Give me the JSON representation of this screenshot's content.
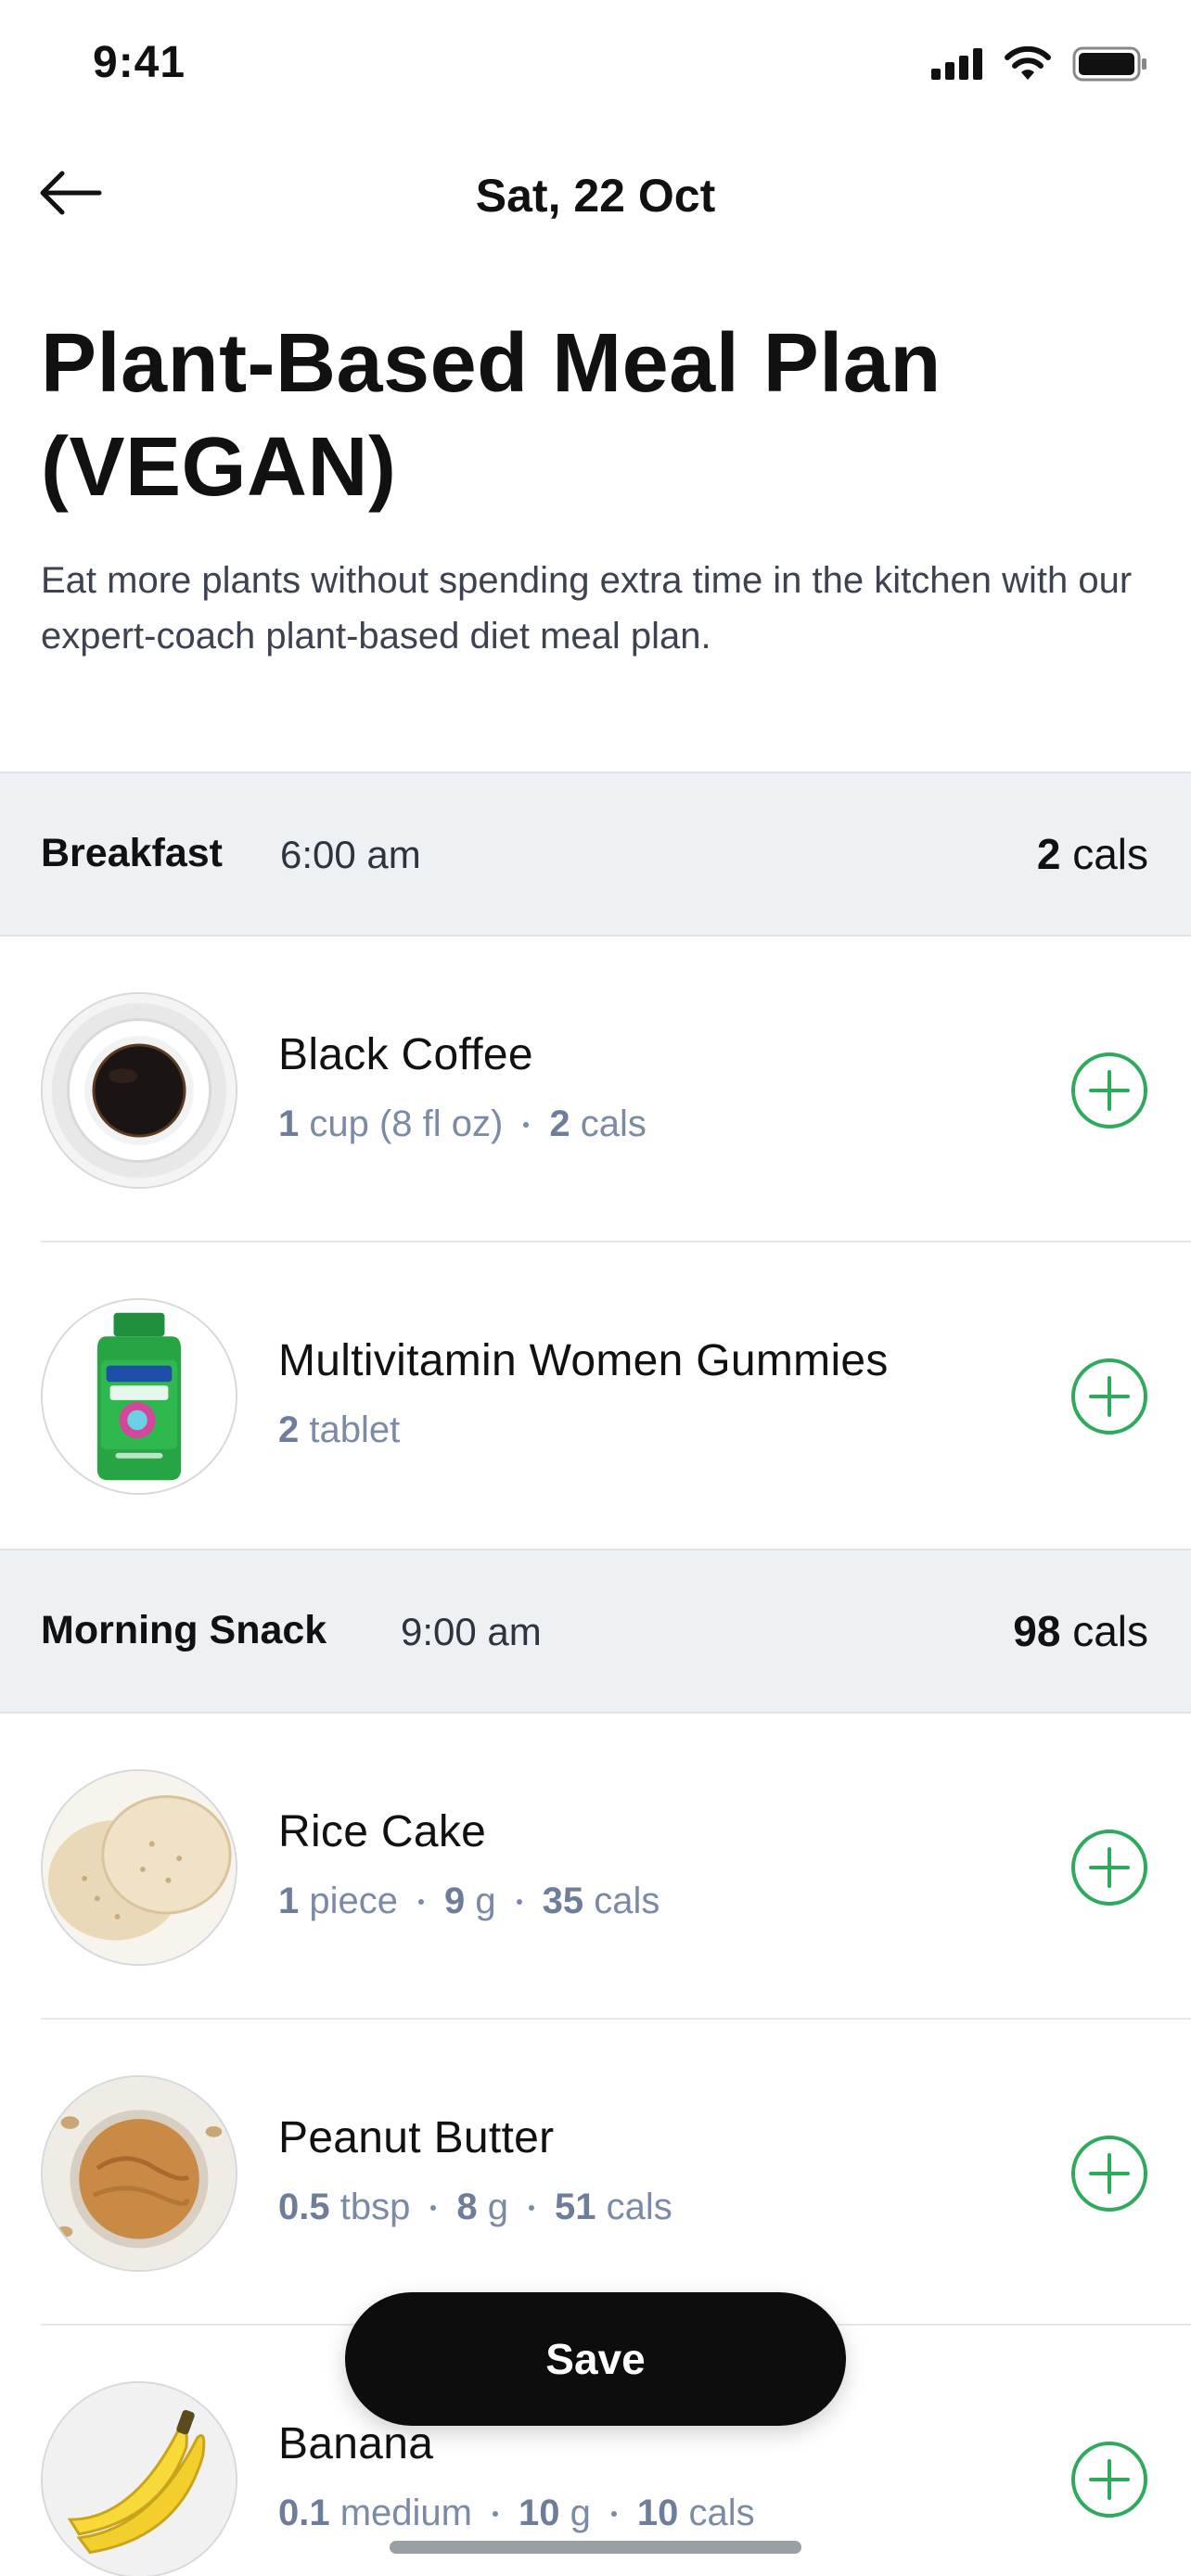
{
  "status_bar": {
    "time": "9:41"
  },
  "nav": {
    "title": "Sat, 22 Oct"
  },
  "header": {
    "title_line1": "Plant-Based Meal Plan",
    "title_line2": "(VEGAN)",
    "description": "Eat more plants without spending extra time in the kitchen with our expert-coach plant-based diet meal plan."
  },
  "sections": [
    {
      "name": "Breakfast",
      "time": "6:00 am",
      "cals_value": "2",
      "cals_unit": "cals",
      "items": [
        {
          "name": "Black Coffee",
          "meta": [
            {
              "num": "1",
              "unit": "cup (8 fl oz)"
            },
            {
              "num": "2",
              "unit": "cals"
            }
          ],
          "image": "black-coffee"
        },
        {
          "name": "Multivitamin Women Gummies",
          "meta": [
            {
              "num": "2",
              "unit": "tablet"
            }
          ],
          "image": "multivitamin-bottle"
        }
      ]
    },
    {
      "name": "Morning Snack",
      "time": "9:00 am",
      "cals_value": "98",
      "cals_unit": "cals",
      "items": [
        {
          "name": "Rice Cake",
          "meta": [
            {
              "num": "1",
              "unit": "piece"
            },
            {
              "num": "9",
              "unit": "g"
            },
            {
              "num": "35",
              "unit": "cals"
            }
          ],
          "image": "rice-cake"
        },
        {
          "name": "Peanut Butter",
          "meta": [
            {
              "num": "0.5",
              "unit": "tbsp"
            },
            {
              "num": "8",
              "unit": "g"
            },
            {
              "num": "51",
              "unit": "cals"
            }
          ],
          "image": "peanut-butter"
        },
        {
          "name": "Banana",
          "meta": [
            {
              "num": "0.1",
              "unit": "medium"
            },
            {
              "num": "10",
              "unit": "g"
            },
            {
              "num": "10",
              "unit": "cals"
            }
          ],
          "image": "banana"
        }
      ]
    }
  ],
  "save_button": {
    "label": "Save"
  },
  "colors": {
    "accent_green": "#2eaa5c",
    "section_bg": "#eef1f4",
    "meta_text": "#7b8aa5",
    "save_bg": "#0d0d0d"
  },
  "icons": {
    "back": "arrow-left-icon",
    "add": "plus-circle-icon",
    "signal": "signal-icon",
    "wifi": "wifi-icon",
    "battery": "battery-icon"
  }
}
